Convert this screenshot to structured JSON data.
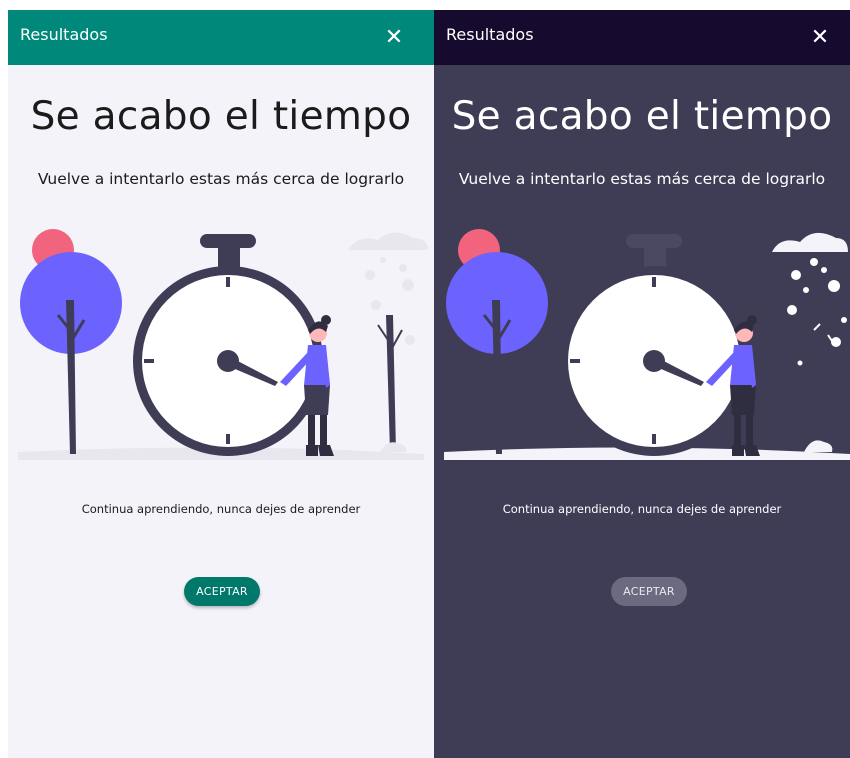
{
  "colors": {
    "light_appbar": "#00897b",
    "dark_appbar": "#160b2e",
    "light_bg": "#f4f3fa",
    "dark_bg": "#3f3d56",
    "accent_purple": "#6c63ff",
    "accent_pink": "#f2637e"
  },
  "light": {
    "app_bar": {
      "title": "Resultados",
      "close_icon": "close-icon"
    },
    "heading": "Se acabo el tiempo",
    "subheading": "Vuelve a intentarlo estas más cerca de lograrlo",
    "message": "Continua aprendiendo, nunca dejes de aprender",
    "accept_label": "ACEPTAR"
  },
  "dark": {
    "app_bar": {
      "title": "Resultados",
      "close_icon": "close-icon"
    },
    "heading": "Se acabo el tiempo",
    "subheading": "Vuelve a intentarlo estas más cerca de lograrlo",
    "message": "Continua aprendiendo, nunca dejes de aprender",
    "accept_label": "ACEPTAR"
  }
}
